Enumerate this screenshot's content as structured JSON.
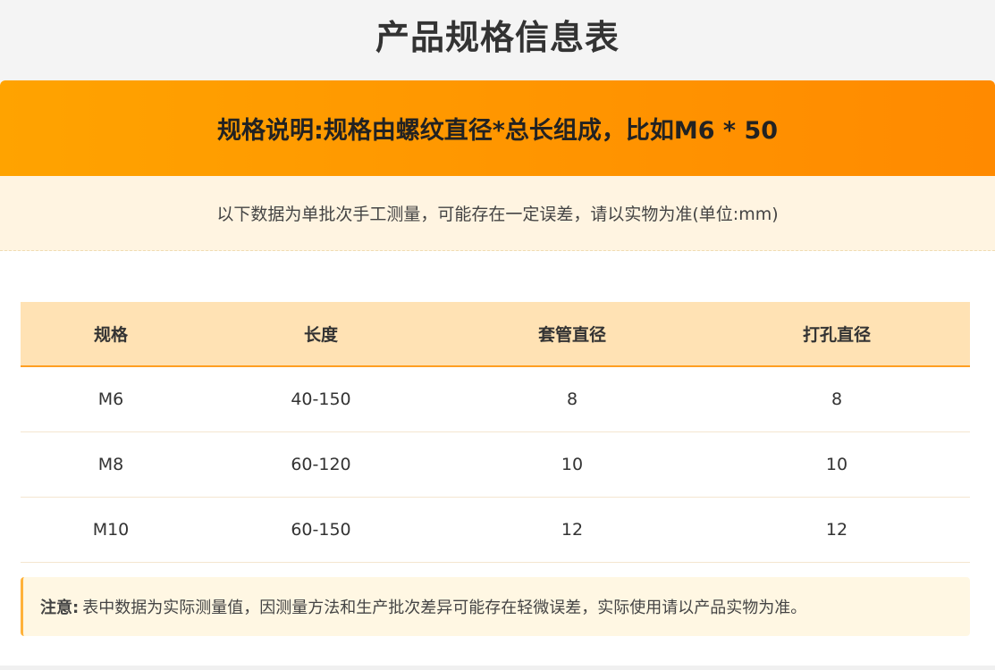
{
  "page": {
    "title": "产品规格信息表"
  },
  "banner": {
    "text": "规格说明:规格由螺纹直径*总长组成，比如M6 * 50"
  },
  "subnote": {
    "text": "以下数据为单批次手工测量，可能存在一定误差，请以实物为准(单位:mm)"
  },
  "table": {
    "headers": [
      "规格",
      "长度",
      "套管直径",
      "打孔直径"
    ],
    "rows": [
      [
        "M6",
        "40-150",
        "8",
        "8"
      ],
      [
        "M8",
        "60-120",
        "10",
        "10"
      ],
      [
        "M10",
        "60-150",
        "12",
        "12"
      ]
    ]
  },
  "notice": {
    "label": "注意:",
    "text": "表中数据为实际测量值，因测量方法和生产批次差异可能存在轻微误差，实际使用请以产品实物为准。"
  },
  "colors": {
    "accent": "#ff9500",
    "header_bg": "#ffe2b4",
    "note_bg": "#fff4e1"
  }
}
